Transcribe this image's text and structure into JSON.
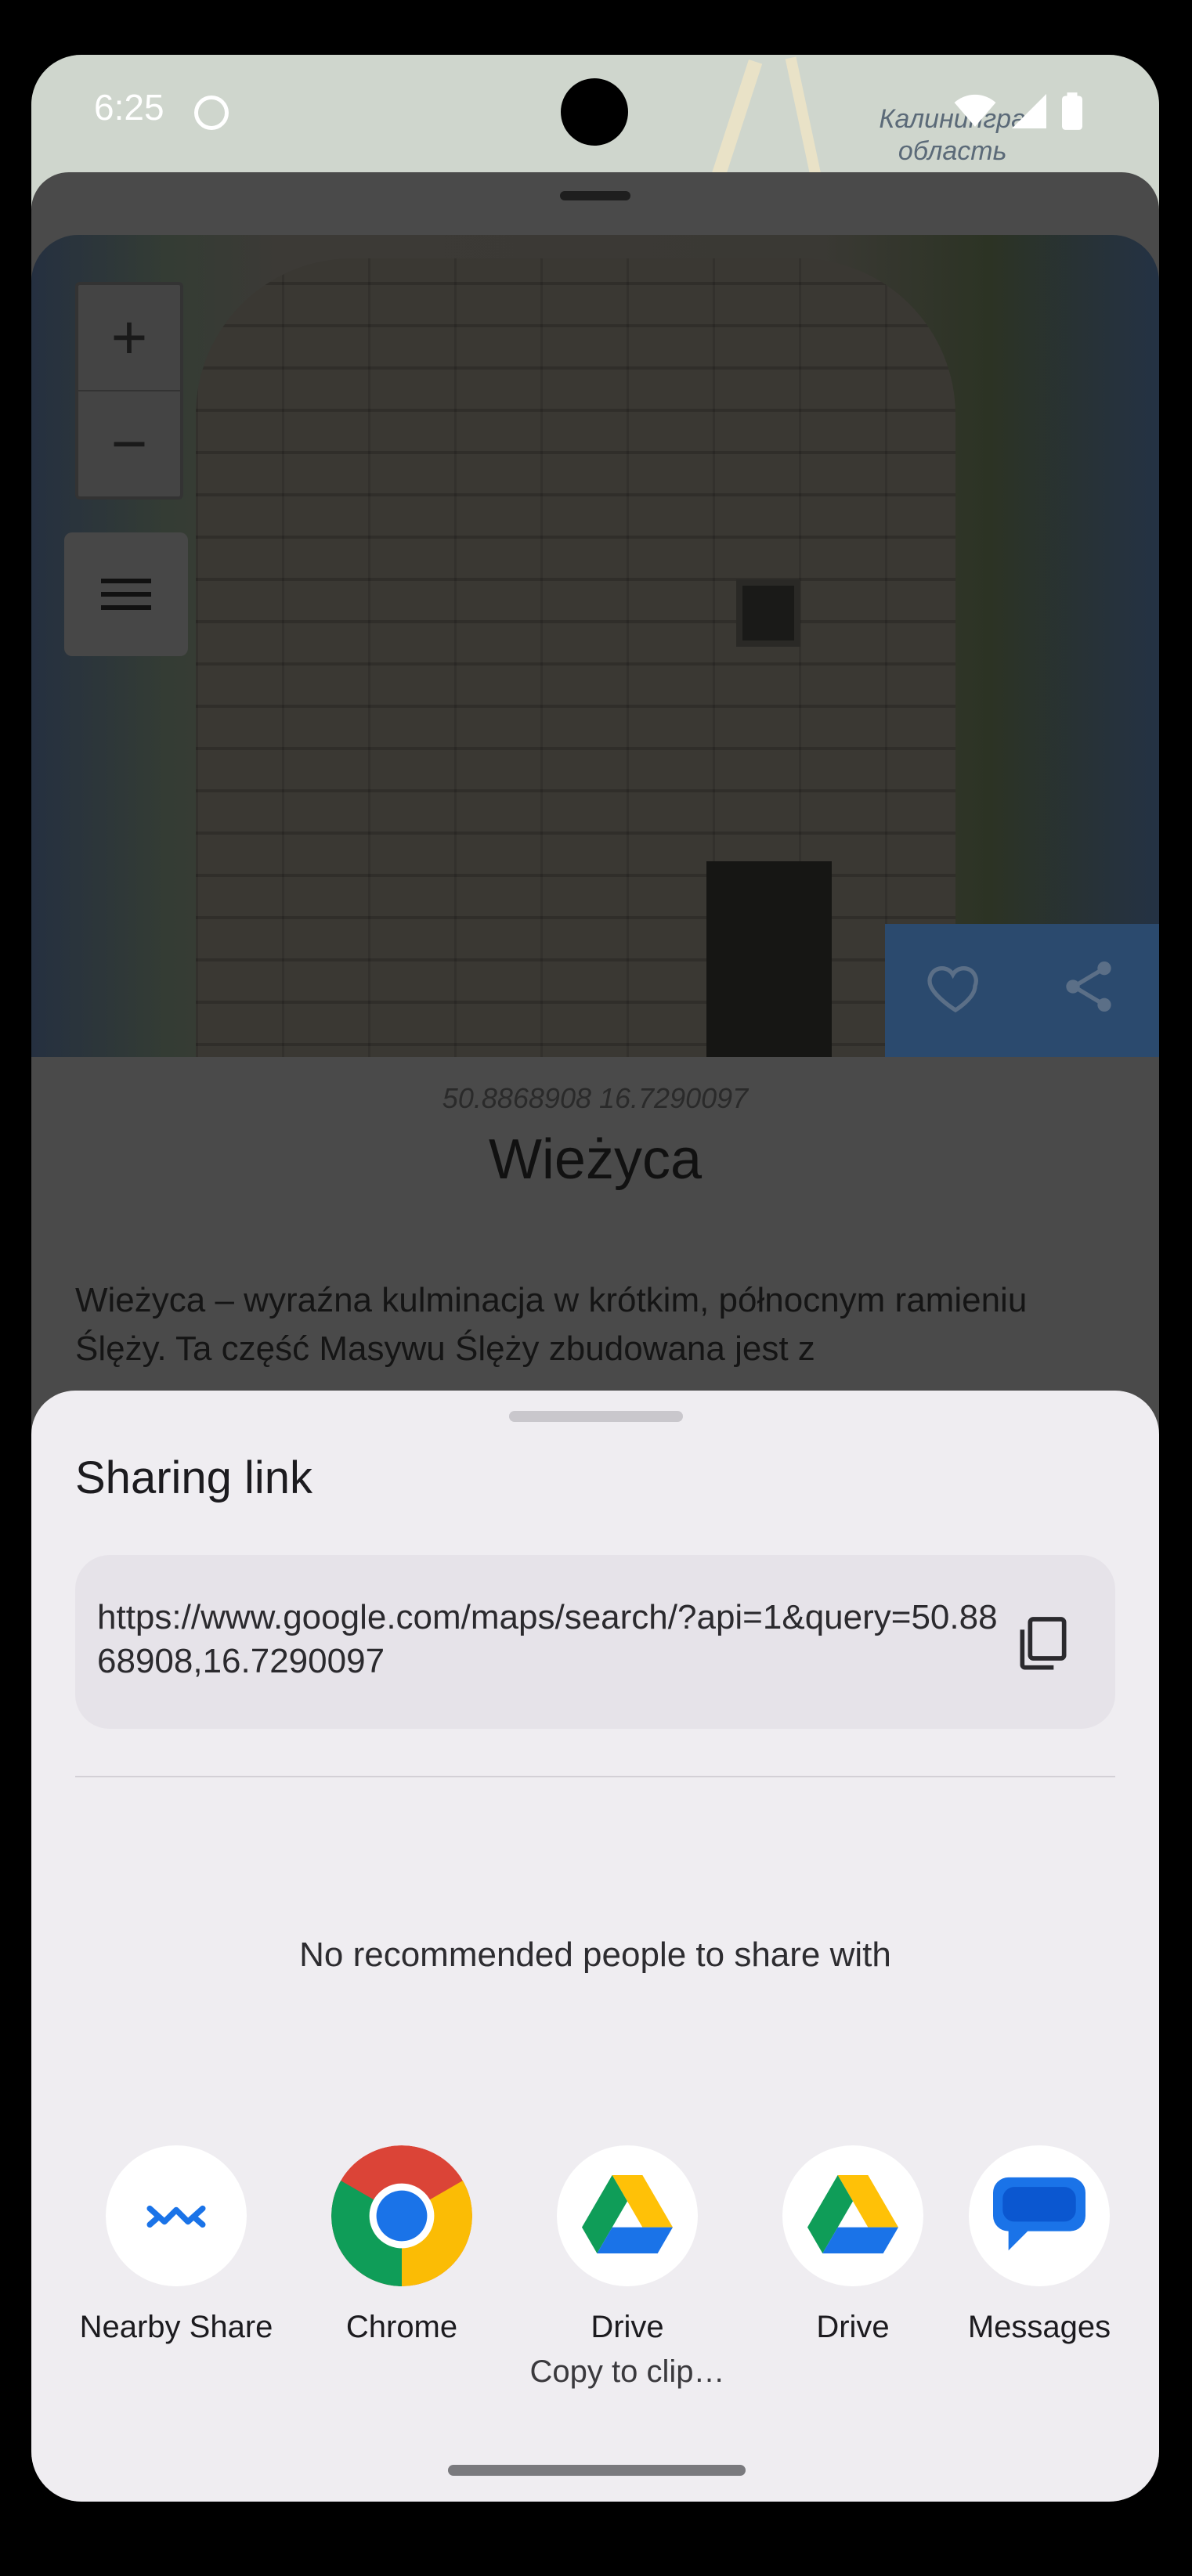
{
  "status_bar": {
    "time": "6:25"
  },
  "map": {
    "label_line1": "Калинингра",
    "label_line2": "область"
  },
  "map_controls": {
    "zoom_in": "+",
    "zoom_out": "−"
  },
  "place": {
    "coordinates": "50.8868908 16.7290097",
    "name": "Wieżyca",
    "description": "Wieżyca – wyraźna kulminacja w krótkim, północnym ramieniu Ślęży. Ta część Masywu Ślęży zbudowana jest z"
  },
  "share_sheet": {
    "title": "Sharing link",
    "link": "https://www.google.com/maps/search/?api=1&query=50.8868908,16.7290097",
    "no_people_text": "No recommended people to share with",
    "apps": [
      {
        "label": "Nearby Share",
        "icon": "nearby-share-icon"
      },
      {
        "label": "Chrome",
        "icon": "chrome-icon"
      },
      {
        "label": "Drive",
        "sub": "Copy to clip…",
        "icon": "drive-icon"
      },
      {
        "label": "Drive",
        "icon": "drive-icon"
      },
      {
        "label": "Messages",
        "icon": "messages-icon"
      }
    ]
  },
  "colors": {
    "accent": "#1a73e8",
    "sheet_bg": "#efedf1"
  }
}
